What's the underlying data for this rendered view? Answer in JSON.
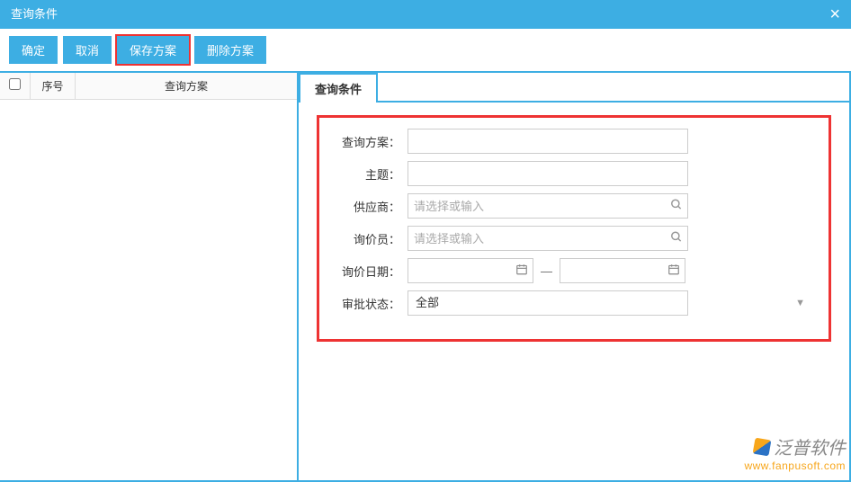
{
  "titlebar": {
    "title": "查询条件"
  },
  "toolbar": {
    "confirm": "确定",
    "cancel": "取消",
    "save_plan": "保存方案",
    "delete_plan": "删除方案"
  },
  "grid": {
    "cols": {
      "seq": "序号",
      "plan": "查询方案"
    },
    "rows": []
  },
  "tabs": {
    "conditions": "查询条件"
  },
  "form": {
    "plan": {
      "label": "查询方案：",
      "value": ""
    },
    "subject": {
      "label": "主题：",
      "value": ""
    },
    "supplier": {
      "label": "供应商：",
      "placeholder": "请选择或输入",
      "value": ""
    },
    "inquirer": {
      "label": "询价员：",
      "placeholder": "请选择或输入",
      "value": ""
    },
    "inquiry_date": {
      "label": "询价日期：",
      "from": "",
      "to": "",
      "sep": "—"
    },
    "approval": {
      "label": "审批状态：",
      "value": "全部",
      "options": [
        "全部"
      ]
    }
  },
  "watermark": {
    "brand": "泛普软件",
    "url": "www.fanpusoft.com"
  }
}
